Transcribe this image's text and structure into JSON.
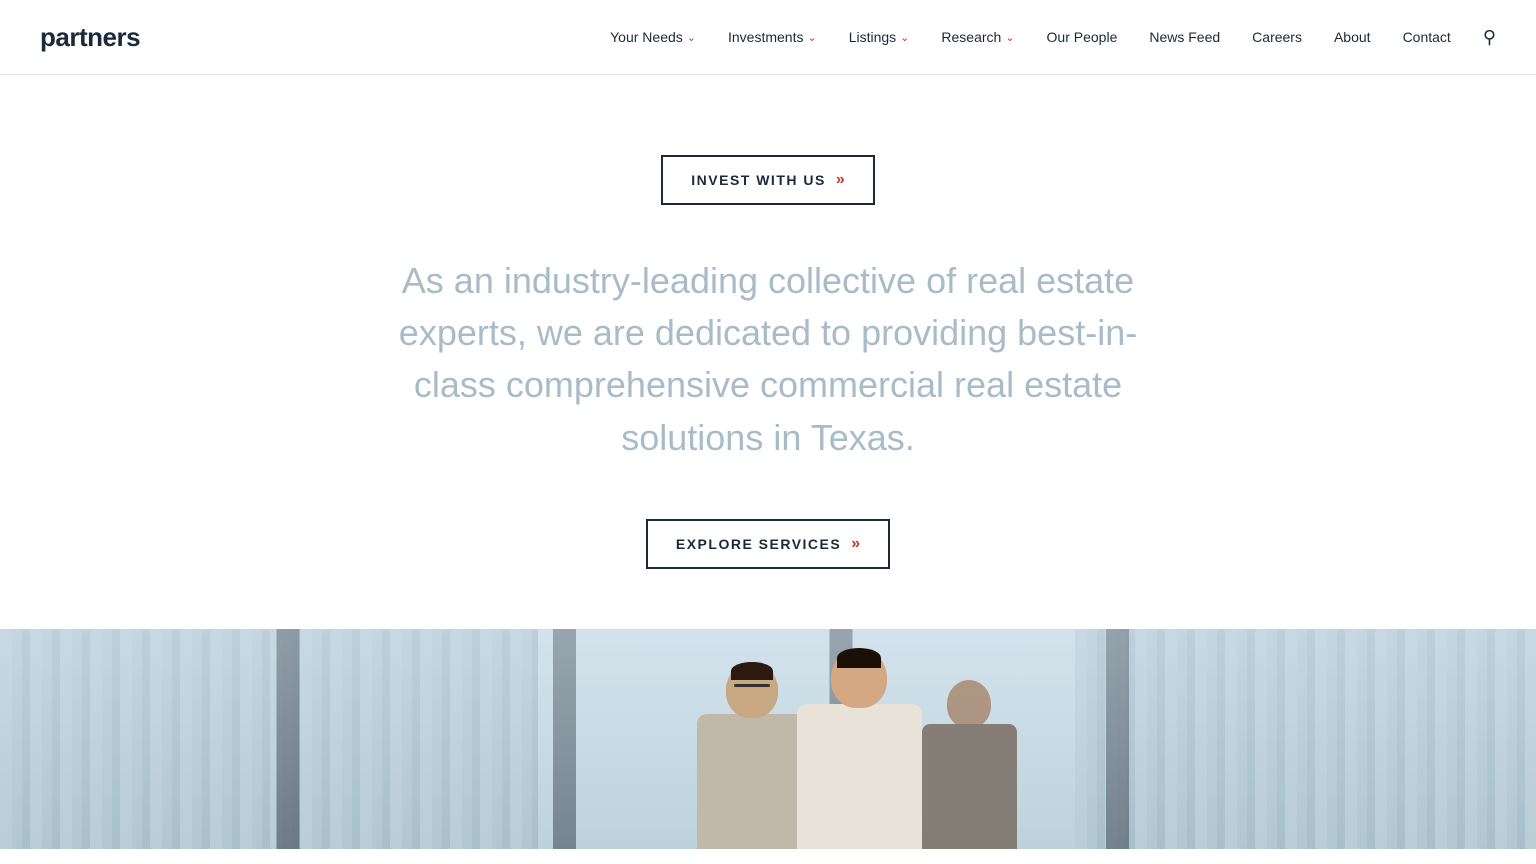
{
  "logo": {
    "text": "partners"
  },
  "nav": {
    "items": [
      {
        "id": "your-needs",
        "label": "Your Needs",
        "hasDropdown": true
      },
      {
        "id": "investments",
        "label": "Investments",
        "hasDropdown": true
      },
      {
        "id": "listings",
        "label": "Listings",
        "hasDropdown": true
      },
      {
        "id": "research",
        "label": "Research",
        "hasDropdown": true
      },
      {
        "id": "our-people",
        "label": "Our People",
        "hasDropdown": false
      },
      {
        "id": "news-feed",
        "label": "News Feed",
        "hasDropdown": false
      },
      {
        "id": "careers",
        "label": "Careers",
        "hasDropdown": false
      },
      {
        "id": "about",
        "label": "About",
        "hasDropdown": false
      },
      {
        "id": "contact",
        "label": "Contact",
        "hasDropdown": false
      }
    ]
  },
  "hero": {
    "invest_button_label": "INVEST WITH US",
    "invest_button_chevrons": "»",
    "hero_text": "As an industry-leading collective of real estate experts, we are dedicated to providing best-in-class comprehensive commercial real estate solutions in Texas.",
    "explore_button_label": "EXPLORE SERVICES",
    "explore_button_chevrons": "»"
  },
  "colors": {
    "accent_red": "#c0392b",
    "dark_navy": "#1a2a3a",
    "text_light_blue": "#a8bcc8",
    "border_dark": "#1a2a3a"
  }
}
